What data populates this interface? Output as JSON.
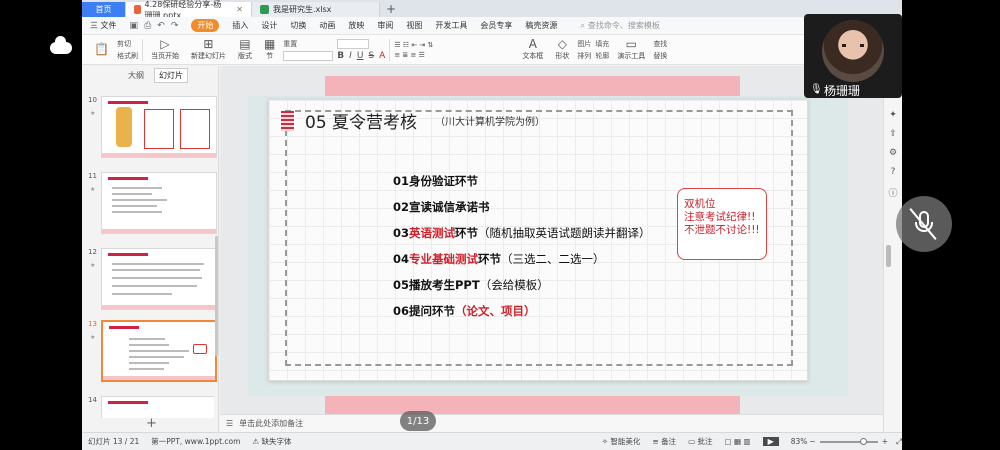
{
  "titlebar": {
    "home_label": "首页",
    "tab1_title": "4.28保研经验分享-杨珊珊.pptx",
    "tab2_title": "我是研究生.xlsx",
    "new_tab": "+"
  },
  "menubar": {
    "file_label": "三 文件",
    "items": [
      "开始",
      "插入",
      "设计",
      "切换",
      "动画",
      "放映",
      "审阅",
      "视图",
      "开发工具",
      "会员专享",
      "稿壳资源"
    ],
    "active_index": 0,
    "search_placeholder": "查找命令、搜索模板"
  },
  "ribbon": {
    "groups": [
      "剪切",
      "格式刷",
      "当页开始",
      "新建幻灯片",
      "版式",
      "节",
      "重置"
    ],
    "format_glyphs": [
      "B",
      "I",
      "U",
      "S",
      "A"
    ],
    "right_groups": [
      "文本框",
      "形状",
      "排列",
      "轮廓",
      "演示工具",
      "查找",
      "替换"
    ],
    "extra": [
      "图片",
      "填充",
      "转换"
    ]
  },
  "leftpanel": {
    "tabs": [
      "大纲",
      "幻灯片"
    ],
    "active_tab": 1,
    "slides": [
      {
        "num": "10"
      },
      {
        "num": "11"
      },
      {
        "num": "12"
      },
      {
        "num": "13"
      },
      {
        "num": "14"
      }
    ],
    "selected_slide": "13",
    "add_label": "+"
  },
  "slide": {
    "title": "05 夏令营考核",
    "subtitle": "（川大计算机学院为例）",
    "items": [
      {
        "prefix": "01身份验证环节",
        "red": "",
        "suffix": "",
        "extra": "",
        "extra_red": ""
      },
      {
        "prefix": "02宣读诚信承诺书",
        "red": "",
        "suffix": "",
        "extra": "",
        "extra_red": ""
      },
      {
        "prefix": "03",
        "red": "英语测试",
        "suffix": "环节",
        "extra": "（随机抽取英语试题朗读并翻译）",
        "extra_red": ""
      },
      {
        "prefix": "04",
        "red": "专业基础测试",
        "suffix": "环节",
        "extra": "（三选二、二选一）",
        "extra_red": ""
      },
      {
        "prefix": "05播放考生PPT",
        "red": "",
        "suffix": "",
        "extra": "（会给模板）",
        "extra_red": ""
      },
      {
        "prefix": "06提问环节",
        "red": "",
        "suffix": "",
        "extra": "",
        "extra_red": "（论文、项目）"
      }
    ],
    "note_lines": [
      "双机位",
      "注意考试纪律!!",
      "不泄题不讨论!!!"
    ]
  },
  "notes": {
    "placeholder": "单击此处添加备注"
  },
  "page_indicator": "1/13",
  "statusbar": {
    "slide_count": "幻灯片 13 / 21",
    "theme": "第一PPT, www.1ppt.com",
    "missing_font": "缺失字体",
    "smart_beautify": "智能美化",
    "notes": "备注",
    "comments": "批注",
    "zoom": "83%"
  },
  "video": {
    "speaker": "杨珊珊"
  }
}
